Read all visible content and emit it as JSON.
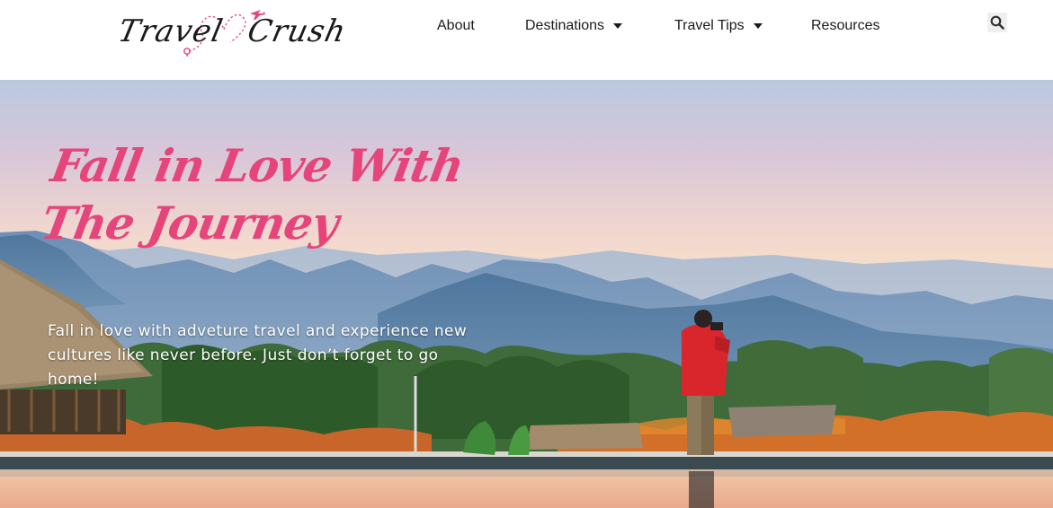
{
  "header": {
    "logo": {
      "word1": "Travel",
      "word2": "Crush"
    },
    "nav": [
      {
        "label": "About",
        "has_dropdown": false
      },
      {
        "label": "Destinations",
        "has_dropdown": true
      },
      {
        "label": "Travel Tips",
        "has_dropdown": true
      },
      {
        "label": "Resources",
        "has_dropdown": false
      }
    ],
    "search_icon": "search-icon"
  },
  "hero": {
    "title_line1": "Fall in Love With",
    "title_line2": "The Journey",
    "subtitle": "Fall in love with adveture travel and experience new cultures like never before.  Just don’t forget to go home!"
  },
  "colors": {
    "accent_pink": "#e5457a",
    "nav_text": "#1b1b1b",
    "hero_text": "#ffffff"
  }
}
